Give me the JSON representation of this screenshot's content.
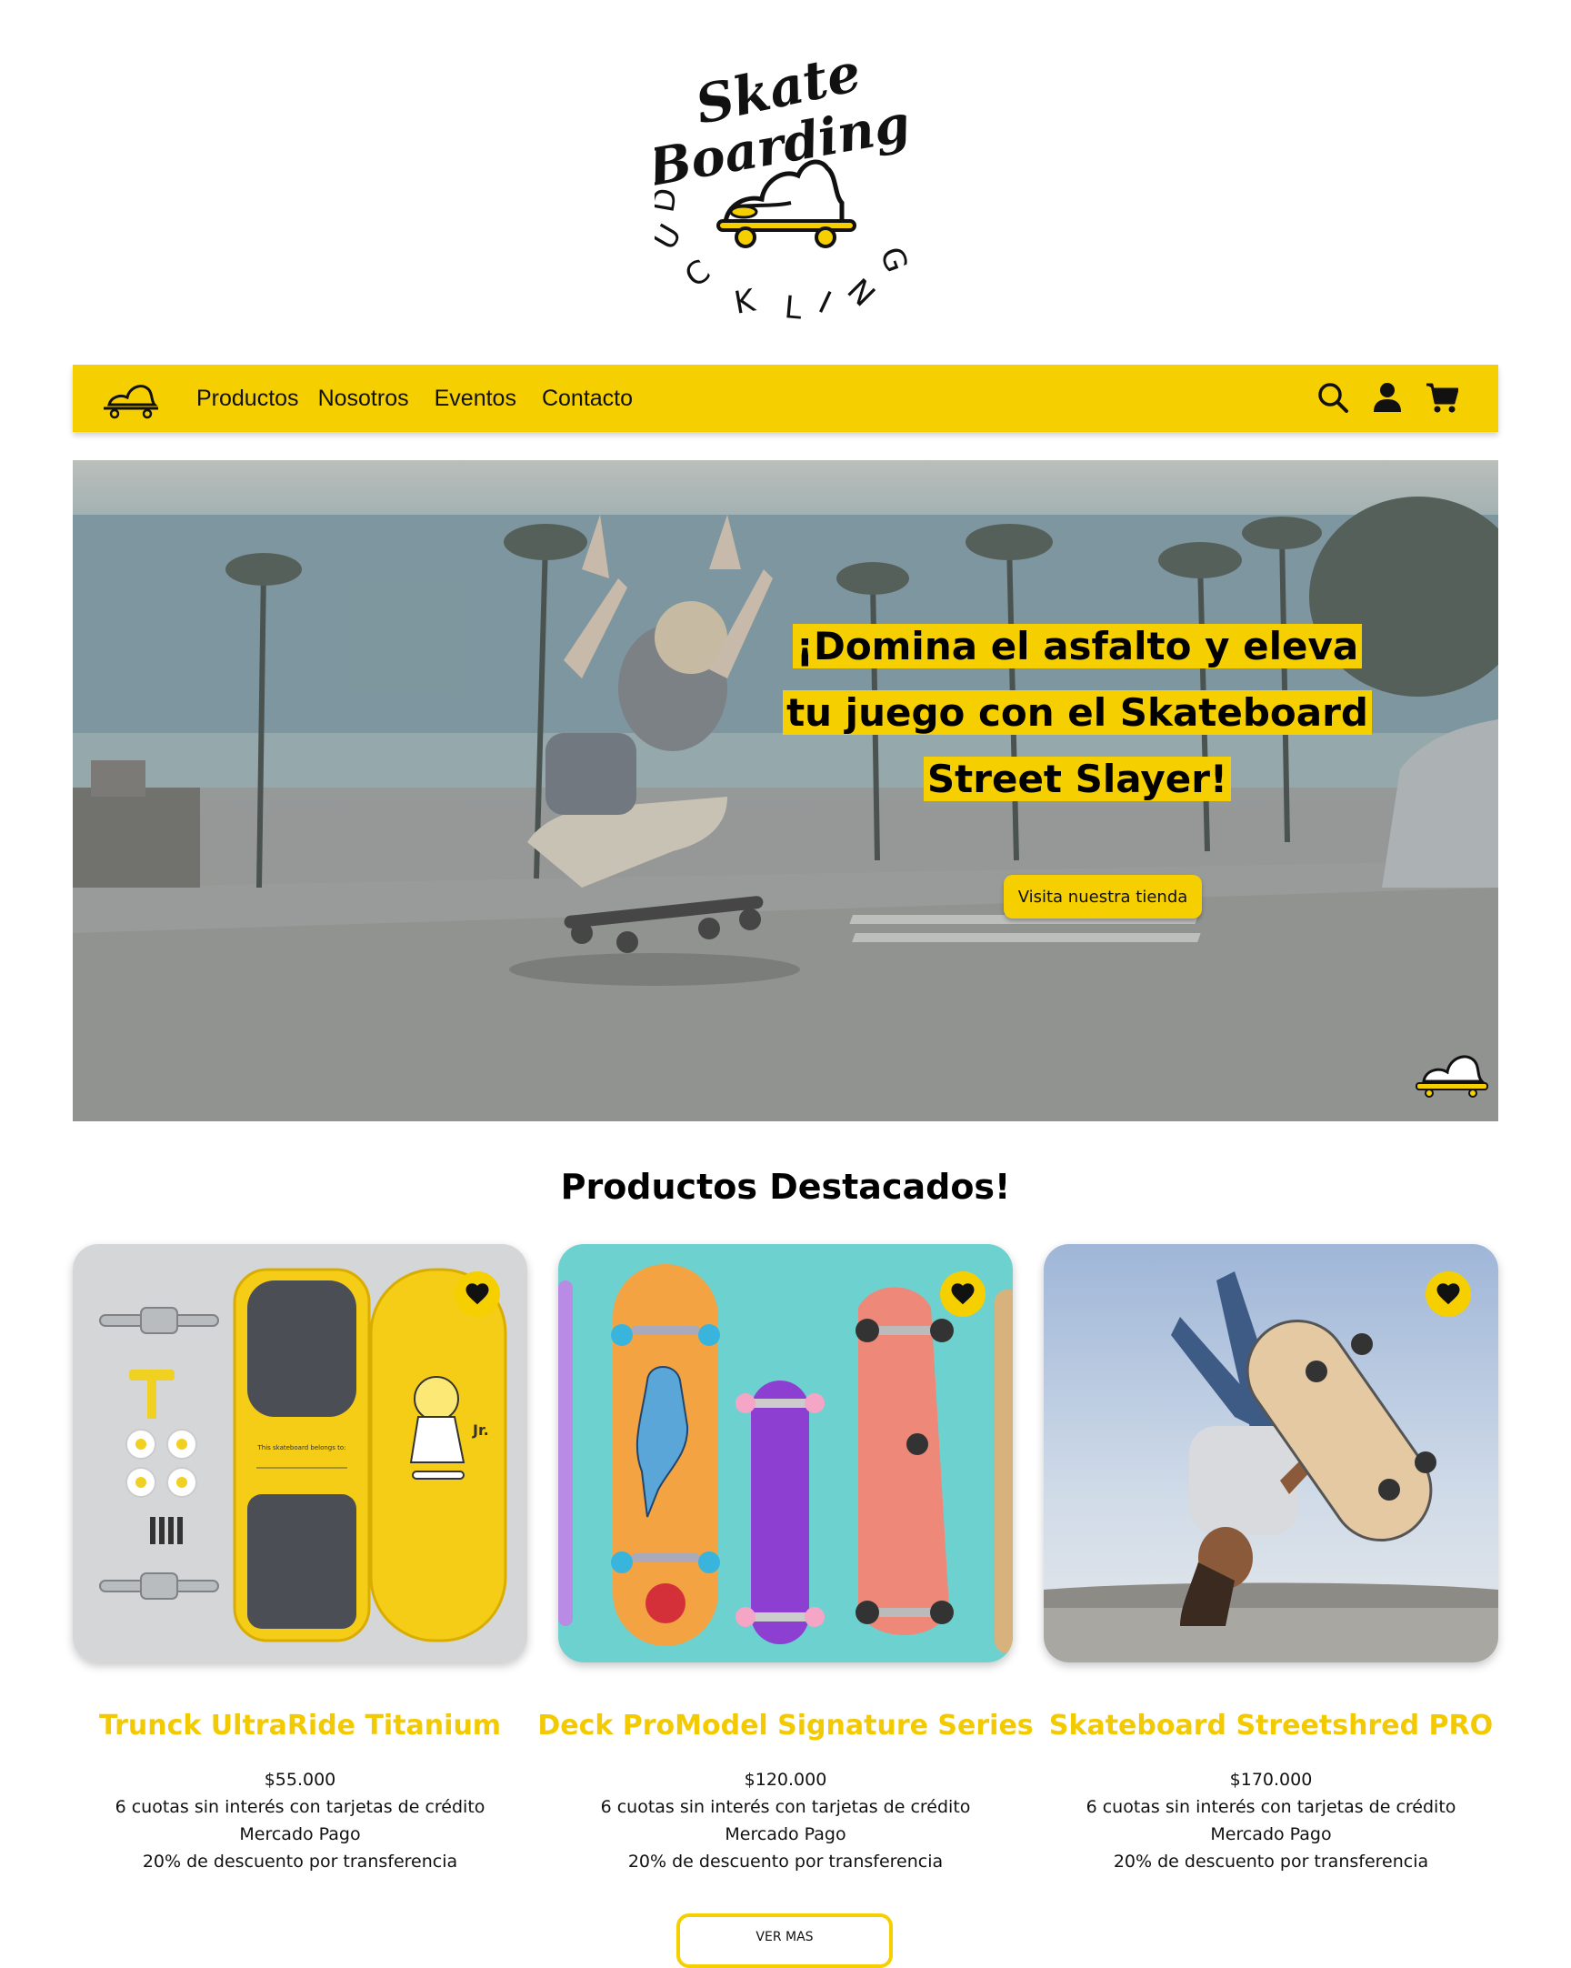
{
  "brand": {
    "logo_line1": "Skate",
    "logo_line2": "Boarding",
    "logo_ring": "DUCKLING",
    "colors": {
      "accent": "#f6cf00",
      "title": "#f3c900",
      "text": "#111111"
    }
  },
  "nav": {
    "links": [
      "Productos",
      "Nosotros",
      "Eventos",
      "Contacto"
    ],
    "icons": [
      "search-icon",
      "user-icon",
      "cart-icon"
    ]
  },
  "hero": {
    "headline": "¡Domina el asfalto y eleva tu juego con el Skateboard Street Slayer!",
    "cta": "Visita nuestra tienda"
  },
  "featured": {
    "title": "Productos Destacados!",
    "products": [
      {
        "name": "Trunck UltraRide Titanium",
        "price": "$55.000",
        "installments": "6 cuotas sin interés con tarjetas de crédito",
        "payment": "Mercado Pago",
        "discount": "20% de descuento por transferencia",
        "image_text": "This skateboard belongs to:"
      },
      {
        "name": "Deck ProModel Signature Series",
        "price": "$120.000",
        "installments": "6 cuotas sin interés con tarjetas de crédito",
        "payment": "Mercado Pago",
        "discount": "20% de descuento por transferencia"
      },
      {
        "name": "Skateboard Streetshred PRO",
        "price": "$170.000",
        "installments": "6 cuotas sin interés con tarjetas de crédito",
        "payment": "Mercado Pago",
        "discount": "20% de descuento por transferencia"
      }
    ],
    "see_more": "VER MAS"
  }
}
